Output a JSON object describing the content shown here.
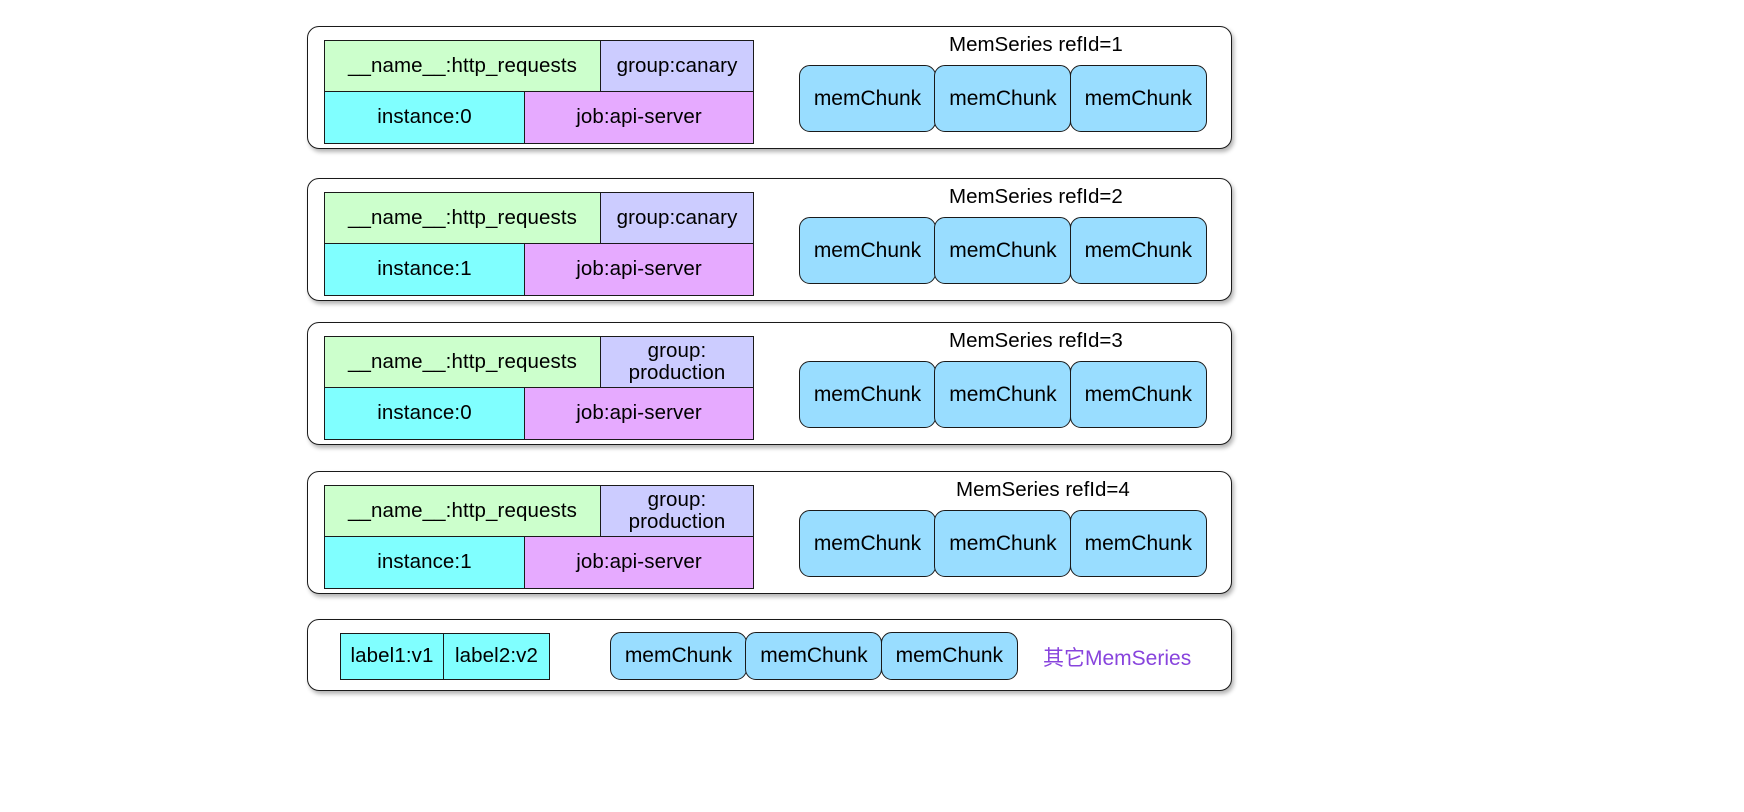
{
  "diagram": {
    "title_prefix": "MemSeries refId=",
    "chunk_label": "memChunk",
    "other_note": "其它MemSeries",
    "colors": {
      "name_label": "#ccffcc",
      "group_label": "#ccccff",
      "instance_label": "#80ffff",
      "job_label": "#e6aaff",
      "chunk": "#99ddff",
      "note_text": "#8844dd",
      "stroke": "#1a1a1a"
    },
    "series": [
      {
        "caption": "MemSeries refId=1",
        "labels": {
          "name": "__name__:http_requests",
          "group": "group:canary",
          "instance": "instance:0",
          "job": "job:api-server"
        },
        "chunks": [
          "memChunk",
          "memChunk",
          "memChunk"
        ]
      },
      {
        "caption": "MemSeries refId=2",
        "labels": {
          "name": "__name__:http_requests",
          "group": "group:canary",
          "instance": "instance:1",
          "job": "job:api-server"
        },
        "chunks": [
          "memChunk",
          "memChunk",
          "memChunk"
        ]
      },
      {
        "caption": "MemSeries refId=3",
        "labels": {
          "name": "__name__:http_requests",
          "group": "group:\nproduction",
          "instance": "instance:0",
          "job": "job:api-server"
        },
        "chunks": [
          "memChunk",
          "memChunk",
          "memChunk"
        ]
      },
      {
        "caption": "MemSeries refId=4",
        "labels": {
          "name": "__name__:http_requests",
          "group": "group:\nproduction",
          "instance": "instance:1",
          "job": "job:api-server"
        },
        "chunks": [
          "memChunk",
          "memChunk",
          "memChunk"
        ]
      }
    ],
    "other_series": {
      "labels": {
        "label1": "label1:v1",
        "label2": "label2:v2"
      },
      "chunks": [
        "memChunk",
        "memChunk",
        "memChunk"
      ],
      "note": "其它MemSeries"
    }
  }
}
